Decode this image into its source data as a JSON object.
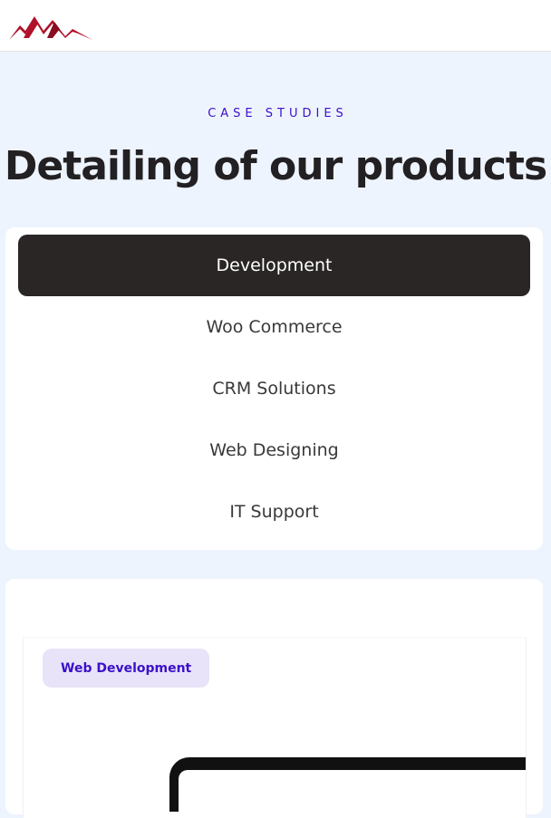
{
  "header": {
    "logo_icon": "mountain-logo-icon",
    "accent_color": "#b0112a"
  },
  "hero": {
    "eyebrow": "CASE STUDIES",
    "title": "Detailing of our products"
  },
  "tabs": [
    {
      "label": "Development",
      "active": true
    },
    {
      "label": "Woo Commerce",
      "active": false
    },
    {
      "label": "CRM Solutions",
      "active": false
    },
    {
      "label": "Web Designing",
      "active": false
    },
    {
      "label": "IT Support",
      "active": false
    }
  ],
  "content": {
    "badge": "Web Development"
  },
  "colors": {
    "page_bg": "#eef4fd",
    "active_tab_bg": "#2a2626",
    "accent": "#3b10c9",
    "badge_bg": "#e8e3f8"
  }
}
